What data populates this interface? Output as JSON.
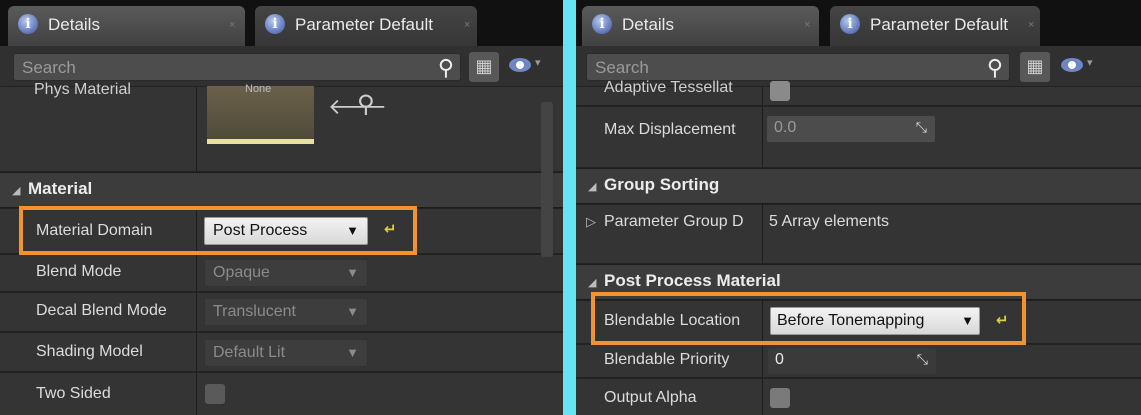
{
  "left": {
    "tabs": [
      {
        "label": "Details",
        "close": "×"
      },
      {
        "label": "Parameter Default",
        "close": "×"
      }
    ],
    "search": {
      "placeholder": "Search",
      "icon": "search-icon"
    },
    "view_options": {
      "grid_icon": "grid-icon",
      "eye_icon": "eye-icon",
      "dropdown_icon": "▾"
    },
    "phys_material": {
      "label": "Phys Material",
      "thumbnail_text": "None",
      "arrow_icon": "arrow-left-icon",
      "browse_icon": "search-icon"
    },
    "material_section": {
      "title": "Material",
      "arrow": "◢"
    },
    "properties": [
      {
        "label": "Material Domain",
        "value": "Post Process",
        "enabled": true,
        "reset": "↵",
        "highlighted": true
      },
      {
        "label": "Blend Mode",
        "value": "Opaque",
        "enabled": false
      },
      {
        "label": "Decal Blend Mode",
        "value": "Translucent",
        "enabled": false
      },
      {
        "label": "Shading Model",
        "value": "Default Lit",
        "enabled": false
      },
      {
        "label": "Two Sided",
        "checkbox": false
      }
    ]
  },
  "right": {
    "tabs": [
      {
        "label": "Details",
        "close": "×"
      },
      {
        "label": "Parameter Default",
        "close": "×"
      }
    ],
    "search": {
      "placeholder": "Search",
      "icon": "search-icon"
    },
    "adaptive_tessellation": {
      "label": "Adaptive Tessellat",
      "checkbox": true
    },
    "max_displacement": {
      "label": "Max Displacement",
      "value": "0.0"
    },
    "group_sorting_section": {
      "title": "Group Sorting",
      "arrow": "◢"
    },
    "parameter_group": {
      "label": "Parameter Group D",
      "value": "5 Array elements",
      "expander": "▷"
    },
    "post_process_section": {
      "title": "Post Process Material",
      "arrow": "◢"
    },
    "blendable_location": {
      "label": "Blendable Location",
      "value": "Before Tonemapping",
      "reset": "↵",
      "highlighted": true
    },
    "blendable_priority": {
      "label": "Blendable Priority",
      "value": "0"
    },
    "output_alpha": {
      "label": "Output Alpha",
      "checkbox": false
    }
  },
  "colors": {
    "highlight": "#f3932e",
    "divider": "#66e4f2",
    "reset_arrow": "#e0d23b"
  }
}
